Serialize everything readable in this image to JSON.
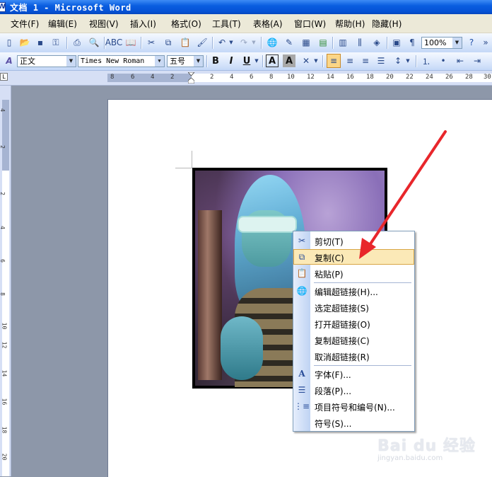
{
  "window": {
    "title": "文档 1 - Microsoft Word"
  },
  "menu": [
    {
      "label": "文件(F)"
    },
    {
      "label": "编辑(E)"
    },
    {
      "label": "视图(V)"
    },
    {
      "label": "插入(I)"
    },
    {
      "label": "格式(O)"
    },
    {
      "label": "工具(T)"
    },
    {
      "label": "表格(A)"
    },
    {
      "label": "窗口(W)"
    },
    {
      "label": "帮助(H)"
    },
    {
      "label": "隐藏(H)"
    }
  ],
  "standard_toolbar": {
    "zoom": "100%"
  },
  "format_toolbar": {
    "style": "正文",
    "font": "Times New Roman",
    "size": "五号",
    "bold": "B",
    "italic": "I",
    "underline": "U",
    "char_border": "A",
    "char_shade": "A"
  },
  "ruler": {
    "h_ticks": [
      "8",
      "6",
      "4",
      "2",
      "2",
      "4",
      "6",
      "8",
      "10",
      "12",
      "14",
      "16",
      "18",
      "20",
      "22",
      "24",
      "26",
      "28",
      "30"
    ],
    "v_ticks": [
      "4",
      "2",
      "2",
      "4",
      "6",
      "8",
      "10",
      "12",
      "14",
      "16",
      "18",
      "20"
    ]
  },
  "context_menu": {
    "items": [
      {
        "label": "剪切(T)",
        "icon": "scissors-icon"
      },
      {
        "label": "复制(C)",
        "icon": "copy-icon",
        "highlighted": true
      },
      {
        "label": "粘贴(P)",
        "icon": "paste-icon"
      },
      {
        "label": "编辑超链接(H)...",
        "icon": "hyperlink-icon"
      },
      {
        "label": "选定超链接(S)",
        "icon": ""
      },
      {
        "label": "打开超链接(O)",
        "icon": ""
      },
      {
        "label": "复制超链接(C)",
        "icon": ""
      },
      {
        "label": "取消超链接(R)",
        "icon": ""
      },
      {
        "label": "字体(F)...",
        "icon": "font-icon"
      },
      {
        "label": "段落(P)...",
        "icon": "paragraph-icon"
      },
      {
        "label": "项目符号和编号(N)...",
        "icon": "bullets-icon"
      },
      {
        "label": "符号(S)...",
        "icon": ""
      }
    ]
  },
  "watermark": {
    "brand": "Bai du 经验",
    "url": "jingyan.baidu.com"
  },
  "colors": {
    "title_bar": "#0a5ee0",
    "menu_highlight": "#fbe9b7",
    "annotation_arrow": "#e8262b"
  }
}
